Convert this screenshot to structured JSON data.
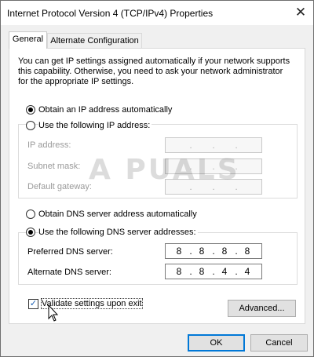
{
  "window": {
    "title": "Internet Protocol Version 4 (TCP/IPv4) Properties",
    "close_glyph": "✕"
  },
  "tabs": [
    {
      "label": "General",
      "selected": true
    },
    {
      "label": "Alternate Configuration",
      "selected": false
    }
  ],
  "description": "You can get IP settings assigned automatically if your network supports this capability. Otherwise, you need to ask your network administrator for the appropriate IP settings.",
  "ip_section": {
    "auto_label": "Obtain an IP address automatically",
    "auto_selected": true,
    "manual_label": "Use the following IP address:",
    "manual_selected": false,
    "fields": [
      {
        "label": "IP address:",
        "value": ".   .   ."
      },
      {
        "label": "Subnet mask:",
        "value": ".   .   ."
      },
      {
        "label": "Default gateway:",
        "value": ".   .   ."
      }
    ]
  },
  "dns_section": {
    "auto_label": "Obtain DNS server address automatically",
    "auto_selected": false,
    "manual_label": "Use the following DNS server addresses:",
    "manual_selected": true,
    "preferred_label": "Preferred DNS server:",
    "preferred_octets": [
      "8",
      "8",
      "8",
      "8"
    ],
    "alternate_label": "Alternate DNS server:",
    "alternate_octets": [
      "8",
      "8",
      "4",
      "4"
    ]
  },
  "validate": {
    "label": "Validate settings upon exit",
    "checked": true
  },
  "buttons": {
    "advanced": "Advanced...",
    "ok": "OK",
    "cancel": "Cancel"
  },
  "watermark_text": "A PUALS",
  "colors": {
    "accent": "#0078d7",
    "window_bg": "#f0f0f0",
    "panel_bg": "#ffffff",
    "disabled_text": "#9a9a9a"
  }
}
